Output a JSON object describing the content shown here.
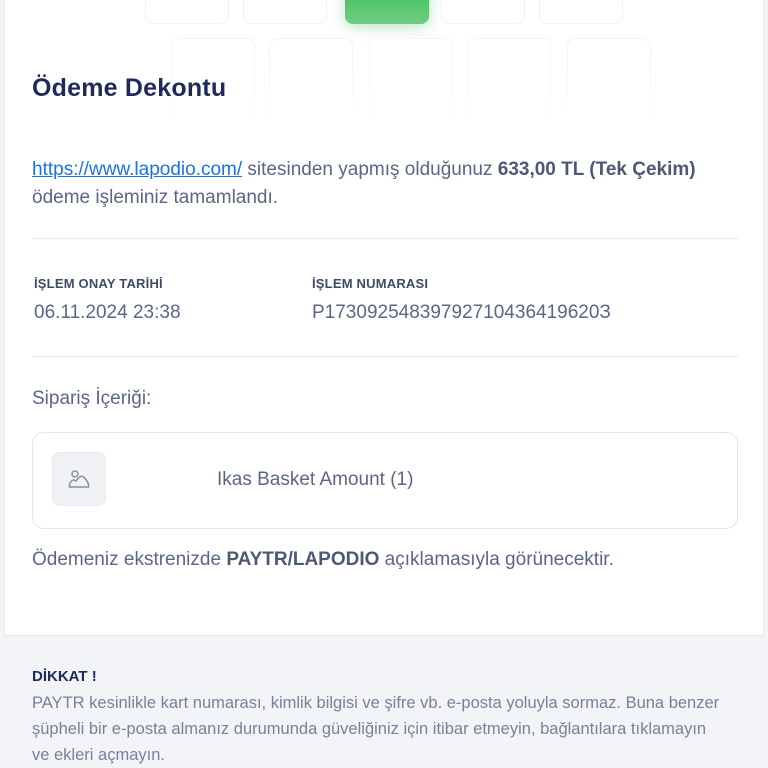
{
  "receipt": {
    "title": "Ödeme Dekontu",
    "intro": {
      "link_text": "https://www.lapodio.com/",
      "text_after_link": " sitesinden yapmış olduğunuz ",
      "amount_text": "633,00 TL (Tek Çekim)",
      "text_end": " ödeme işleminiz tamamlandı."
    },
    "approval_date_label": "İŞLEM ONAY TARİHİ",
    "approval_date_value": "06.11.2024 23:38",
    "transaction_number_label": "İŞLEM NUMARASI",
    "transaction_number_value": "P17309254839792710436419620З"
  },
  "order": {
    "section_label": "Sipariş İçeriği:",
    "items": [
      {
        "name": "Ikas Basket Amount (1)",
        "icon": "image-placeholder-icon"
      }
    ]
  },
  "statement_note": {
    "prefix": "Ödemeniz ekstrenizde ",
    "descriptor": "PAYTR/LAPODIO",
    "suffix": " açıklamasıyla görünecektir."
  },
  "warning": {
    "title": "DİKKAT !",
    "body": "PAYTR kesinlikle kart numarası, kimlik bilgisi ve şifre vb. e-posta yoluyla sormaz. Buna benzer şüpheli bir e-posta almanız durumunda güveliğiniz için itibar etmeyin, bağlantılara tıklamayın ve ekleri açmayın."
  },
  "colors": {
    "title": "#1f2a5c",
    "body_text": "#5b6686",
    "link": "#1b73e8",
    "success_accent": "#52c46a",
    "warning_bg": "#f3f4f7"
  }
}
